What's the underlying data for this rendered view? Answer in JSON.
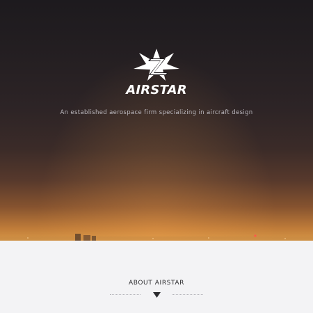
{
  "hero": {
    "logo_icon": "airstar-star-logo-icon",
    "brand_name": "AIRSTAR",
    "tagline": "An established aerospace firm specializing in aircraft design"
  },
  "about": {
    "heading": "ABOUT AIRSTAR",
    "arrow_icon": "triangle-down-icon"
  },
  "colors": {
    "hero_dark": "#1d1a1e",
    "hero_glow": "#d69646",
    "section_bg": "#f3f3f5",
    "heading_text": "#2b2b2e",
    "tagline_text": "#bcb9bf"
  }
}
